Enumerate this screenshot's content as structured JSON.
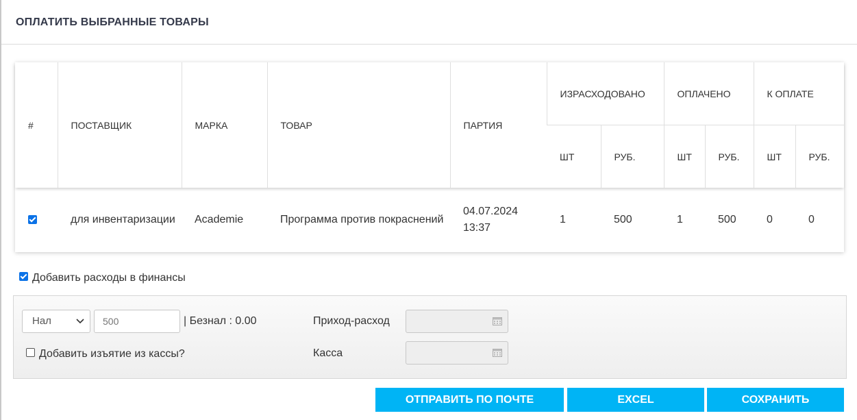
{
  "header": {
    "title": "ОПЛАТИТЬ ВЫБРАННЫЕ ТОВАРЫ"
  },
  "table": {
    "columns": {
      "num": "#",
      "supplier": "ПОСТАВЩИК",
      "brand": "МАРКА",
      "product": "ТОВАР",
      "batch": "ПАРТИЯ",
      "spent": "ИЗРАСХОДОВАНО",
      "paid": "ОПЛАЧЕНО",
      "to_pay": "К ОПЛАТЕ",
      "qty": "ШТ",
      "rub": "РУБ."
    },
    "rows": [
      {
        "checked": true,
        "supplier": "для инвентаризации",
        "brand": "Academie",
        "product": "Программа против покраснений",
        "batch": "04.07.2024 13:37",
        "spent_qty": "1",
        "spent_rub": "500",
        "paid_qty": "1",
        "paid_rub": "500",
        "topay_qty": "0",
        "topay_rub": "0"
      }
    ]
  },
  "finance": {
    "add_expenses_label": "Добавить расходы в финансы",
    "add_expenses_checked": true,
    "payment_type": "Нал",
    "amount_placeholder": "500",
    "beznal_text": "| Безнал : 0.00",
    "withdraw_label": "Добавить изъятие из кассы?",
    "withdraw_checked": false,
    "income_expense_label": "Приход-расход",
    "cashbox_label": "Касса"
  },
  "buttons": {
    "send_email": "ОТПРАВИТЬ ПО ПОЧТЕ",
    "excel": "EXCEL",
    "save": "СОХРАНИТЬ"
  },
  "colors": {
    "accent": "#00b4f5",
    "checkbox": "#0b72e7",
    "title": "#34394a"
  }
}
